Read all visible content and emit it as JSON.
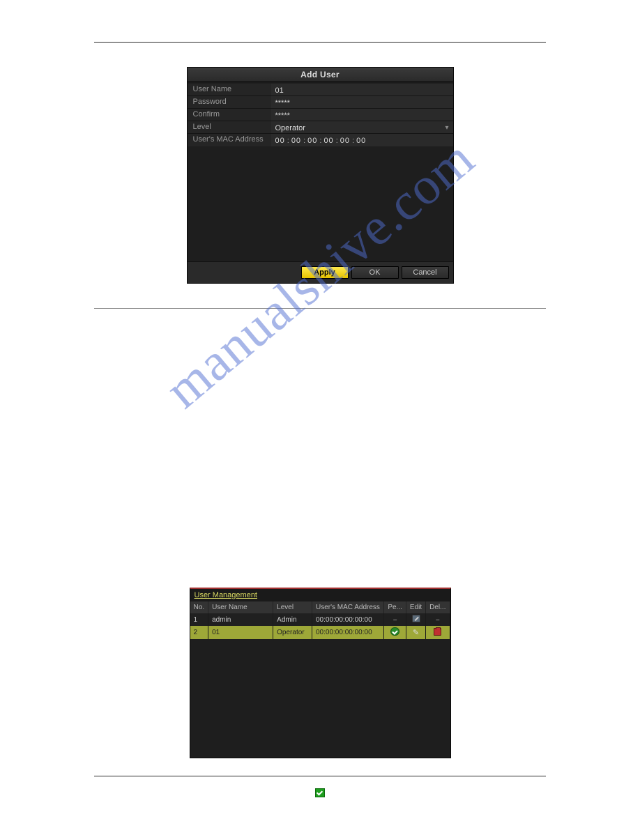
{
  "dialog": {
    "title": "Add User",
    "fields": {
      "username": {
        "label": "User Name",
        "value": "01"
      },
      "password": {
        "label": "Password",
        "value": "*****"
      },
      "confirm": {
        "label": "Confirm",
        "value": "*****"
      },
      "level": {
        "label": "Level",
        "value": "Operator"
      },
      "mac": {
        "label": "User's MAC Address",
        "segments": [
          "00",
          "00",
          "00",
          "00",
          "00",
          "00"
        ]
      }
    },
    "buttons": {
      "apply": "Apply",
      "ok": "OK",
      "cancel": "Cancel"
    }
  },
  "user_management": {
    "title": "User Management",
    "columns": {
      "no": "No.",
      "username": "User Name",
      "level": "Level",
      "mac": "User's MAC Address",
      "pe": "Pe...",
      "edit": "Edit",
      "del": "Del..."
    },
    "rows": [
      {
        "no": "1",
        "username": "admin",
        "level": "Admin",
        "mac": "00:00:00:00:00:00",
        "pe": "dash",
        "edit": "editsq",
        "del": "dash"
      },
      {
        "no": "2",
        "username": "01",
        "level": "Operator",
        "mac": "00:00:00:00:00:00",
        "pe": "check",
        "edit": "pencil",
        "del": "trash"
      }
    ]
  },
  "watermark": "manualshive.com"
}
